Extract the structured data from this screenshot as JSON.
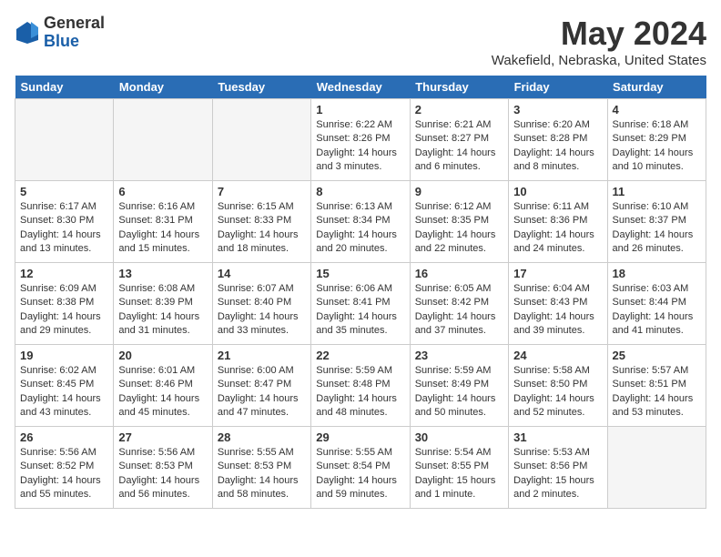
{
  "header": {
    "logo_line1": "General",
    "logo_line2": "Blue",
    "title": "May 2024",
    "subtitle": "Wakefield, Nebraska, United States"
  },
  "days_of_week": [
    "Sunday",
    "Monday",
    "Tuesday",
    "Wednesday",
    "Thursday",
    "Friday",
    "Saturday"
  ],
  "weeks": [
    [
      {
        "num": "",
        "empty": true
      },
      {
        "num": "",
        "empty": true
      },
      {
        "num": "",
        "empty": true
      },
      {
        "num": "1",
        "sunrise": "6:22 AM",
        "sunset": "8:26 PM",
        "daylight": "14 hours and 3 minutes."
      },
      {
        "num": "2",
        "sunrise": "6:21 AM",
        "sunset": "8:27 PM",
        "daylight": "14 hours and 6 minutes."
      },
      {
        "num": "3",
        "sunrise": "6:20 AM",
        "sunset": "8:28 PM",
        "daylight": "14 hours and 8 minutes."
      },
      {
        "num": "4",
        "sunrise": "6:18 AM",
        "sunset": "8:29 PM",
        "daylight": "14 hours and 10 minutes."
      }
    ],
    [
      {
        "num": "5",
        "sunrise": "6:17 AM",
        "sunset": "8:30 PM",
        "daylight": "14 hours and 13 minutes."
      },
      {
        "num": "6",
        "sunrise": "6:16 AM",
        "sunset": "8:31 PM",
        "daylight": "14 hours and 15 minutes."
      },
      {
        "num": "7",
        "sunrise": "6:15 AM",
        "sunset": "8:33 PM",
        "daylight": "14 hours and 18 minutes."
      },
      {
        "num": "8",
        "sunrise": "6:13 AM",
        "sunset": "8:34 PM",
        "daylight": "14 hours and 20 minutes."
      },
      {
        "num": "9",
        "sunrise": "6:12 AM",
        "sunset": "8:35 PM",
        "daylight": "14 hours and 22 minutes."
      },
      {
        "num": "10",
        "sunrise": "6:11 AM",
        "sunset": "8:36 PM",
        "daylight": "14 hours and 24 minutes."
      },
      {
        "num": "11",
        "sunrise": "6:10 AM",
        "sunset": "8:37 PM",
        "daylight": "14 hours and 26 minutes."
      }
    ],
    [
      {
        "num": "12",
        "sunrise": "6:09 AM",
        "sunset": "8:38 PM",
        "daylight": "14 hours and 29 minutes."
      },
      {
        "num": "13",
        "sunrise": "6:08 AM",
        "sunset": "8:39 PM",
        "daylight": "14 hours and 31 minutes."
      },
      {
        "num": "14",
        "sunrise": "6:07 AM",
        "sunset": "8:40 PM",
        "daylight": "14 hours and 33 minutes."
      },
      {
        "num": "15",
        "sunrise": "6:06 AM",
        "sunset": "8:41 PM",
        "daylight": "14 hours and 35 minutes."
      },
      {
        "num": "16",
        "sunrise": "6:05 AM",
        "sunset": "8:42 PM",
        "daylight": "14 hours and 37 minutes."
      },
      {
        "num": "17",
        "sunrise": "6:04 AM",
        "sunset": "8:43 PM",
        "daylight": "14 hours and 39 minutes."
      },
      {
        "num": "18",
        "sunrise": "6:03 AM",
        "sunset": "8:44 PM",
        "daylight": "14 hours and 41 minutes."
      }
    ],
    [
      {
        "num": "19",
        "sunrise": "6:02 AM",
        "sunset": "8:45 PM",
        "daylight": "14 hours and 43 minutes."
      },
      {
        "num": "20",
        "sunrise": "6:01 AM",
        "sunset": "8:46 PM",
        "daylight": "14 hours and 45 minutes."
      },
      {
        "num": "21",
        "sunrise": "6:00 AM",
        "sunset": "8:47 PM",
        "daylight": "14 hours and 47 minutes."
      },
      {
        "num": "22",
        "sunrise": "5:59 AM",
        "sunset": "8:48 PM",
        "daylight": "14 hours and 48 minutes."
      },
      {
        "num": "23",
        "sunrise": "5:59 AM",
        "sunset": "8:49 PM",
        "daylight": "14 hours and 50 minutes."
      },
      {
        "num": "24",
        "sunrise": "5:58 AM",
        "sunset": "8:50 PM",
        "daylight": "14 hours and 52 minutes."
      },
      {
        "num": "25",
        "sunrise": "5:57 AM",
        "sunset": "8:51 PM",
        "daylight": "14 hours and 53 minutes."
      }
    ],
    [
      {
        "num": "26",
        "sunrise": "5:56 AM",
        "sunset": "8:52 PM",
        "daylight": "14 hours and 55 minutes."
      },
      {
        "num": "27",
        "sunrise": "5:56 AM",
        "sunset": "8:53 PM",
        "daylight": "14 hours and 56 minutes."
      },
      {
        "num": "28",
        "sunrise": "5:55 AM",
        "sunset": "8:53 PM",
        "daylight": "14 hours and 58 minutes."
      },
      {
        "num": "29",
        "sunrise": "5:55 AM",
        "sunset": "8:54 PM",
        "daylight": "14 hours and 59 minutes."
      },
      {
        "num": "30",
        "sunrise": "5:54 AM",
        "sunset": "8:55 PM",
        "daylight": "15 hours and 1 minute."
      },
      {
        "num": "31",
        "sunrise": "5:53 AM",
        "sunset": "8:56 PM",
        "daylight": "15 hours and 2 minutes."
      },
      {
        "num": "",
        "empty": true
      }
    ]
  ]
}
